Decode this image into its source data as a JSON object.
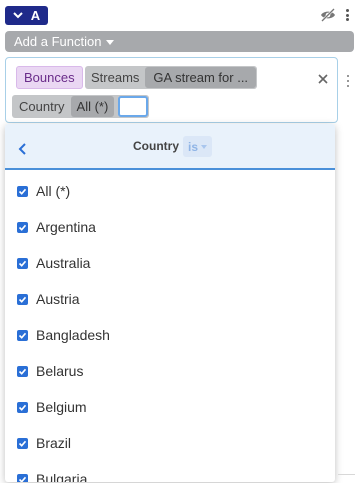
{
  "series": {
    "letter": "A",
    "color": "#1f2a8a"
  },
  "toolbar": {
    "add_function_label": "Add a Function"
  },
  "query": {
    "metric": "Bounces",
    "streams_label": "Streams",
    "streams_value": "GA stream for ...",
    "filter_field": "Country",
    "filter_value": "All (*)",
    "filter_input_value": ""
  },
  "dropdown": {
    "title": "Country",
    "operator": "is",
    "items": [
      {
        "label": "All (*)",
        "checked": true
      },
      {
        "label": "Argentina",
        "checked": true
      },
      {
        "label": "Australia",
        "checked": true
      },
      {
        "label": "Austria",
        "checked": true
      },
      {
        "label": "Bangladesh",
        "checked": true
      },
      {
        "label": "Belarus",
        "checked": true
      },
      {
        "label": "Belgium",
        "checked": true
      },
      {
        "label": "Brazil",
        "checked": true
      },
      {
        "label": "Bulgaria",
        "checked": true
      }
    ]
  },
  "icons": {
    "collapse": "chevron-down-icon",
    "visibility": "eye-off-icon",
    "menu": "kebab-menu-icon",
    "remove": "close-icon",
    "back": "chevron-left-icon",
    "checkbox": "checkbox-checked-icon"
  },
  "colors": {
    "accent_blue": "#2a6fd6",
    "metric_chip_bg": "#ead7f3",
    "add_function_bg": "#a7a9ac",
    "header_bg": "#e9f2fb"
  }
}
